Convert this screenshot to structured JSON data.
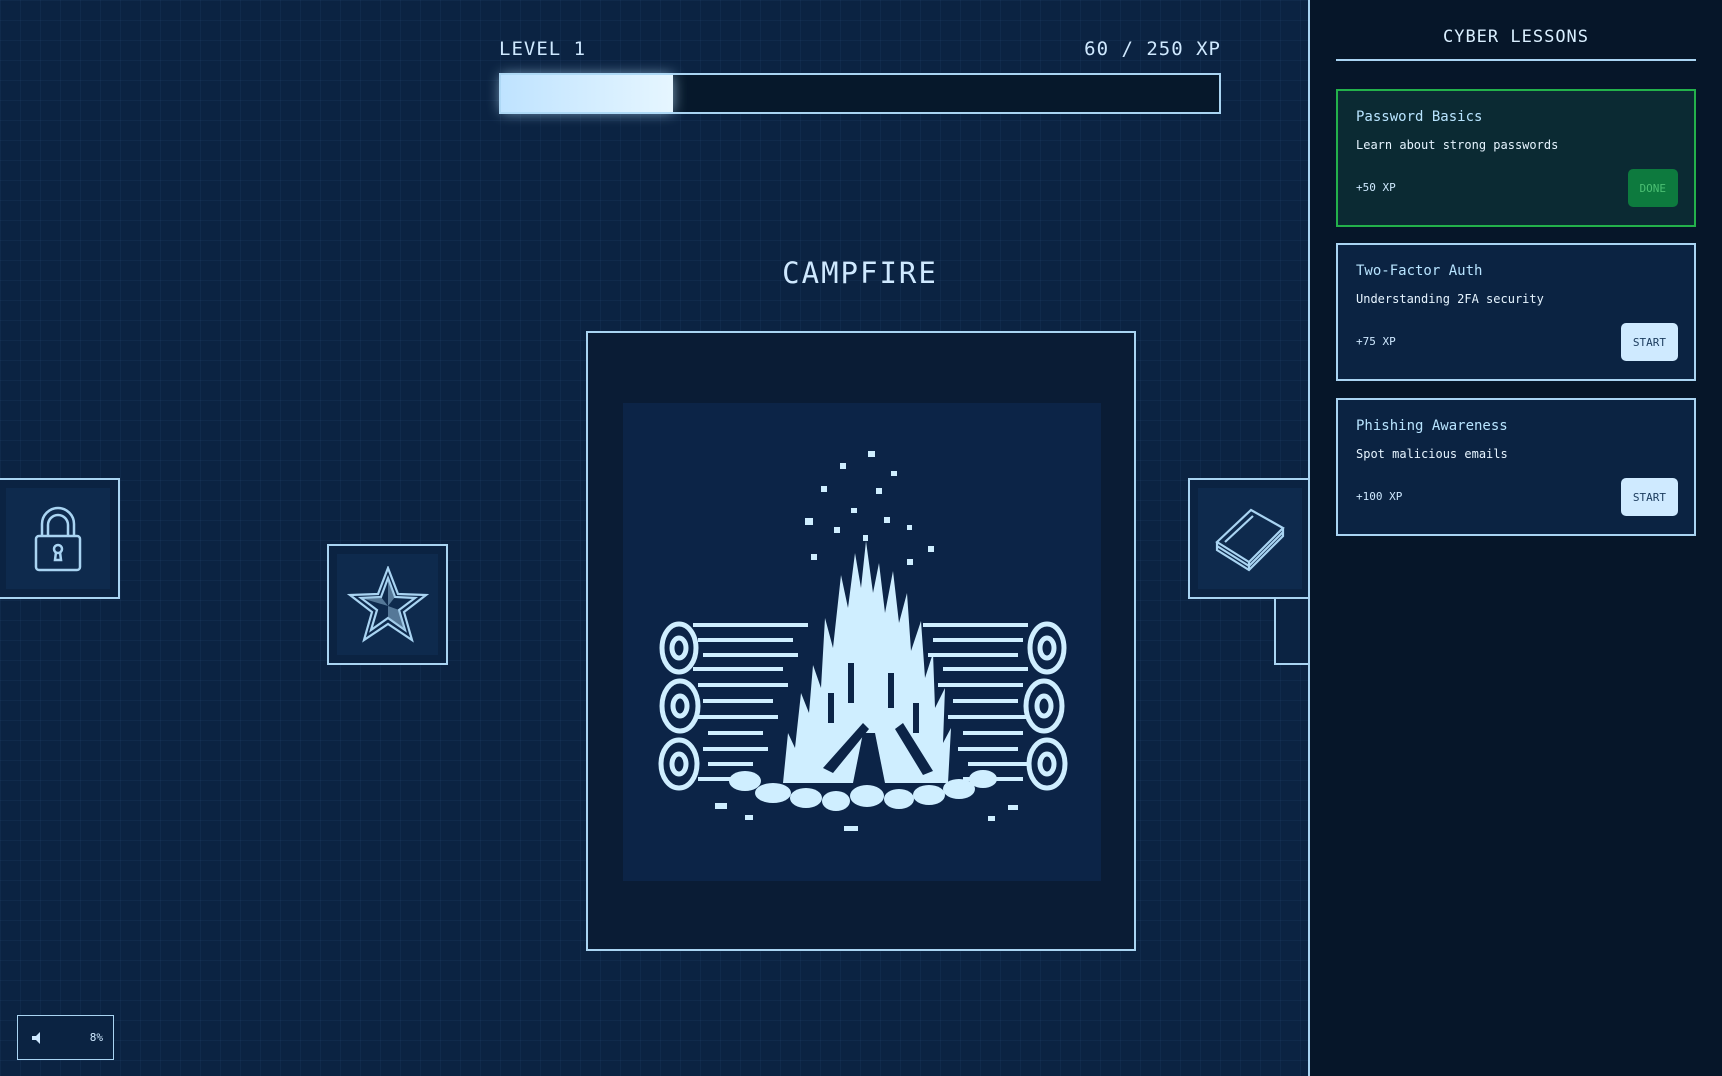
{
  "hud": {
    "level_label": "LEVEL 1",
    "xp_text": "60 / 250 XP",
    "xp_progress": 0.24
  },
  "room": {
    "title": "CAMPFIRE",
    "scene": "campfire-pixel-art"
  },
  "items": [
    {
      "icon": "padlock-icon"
    },
    {
      "icon": "star-icon"
    },
    {
      "icon": "book-icon"
    }
  ],
  "sound": {
    "icon": "speaker-icon",
    "volume_text": "8%"
  },
  "sidebar": {
    "title": "CYBER LESSONS",
    "lessons": [
      {
        "title": "Password Basics",
        "description": "Learn about strong passwords",
        "xp": "+50 XP",
        "button": "DONE",
        "status": "done"
      },
      {
        "title": "Two-Factor Auth",
        "description": "Understanding 2FA security",
        "xp": "+75 XP",
        "button": "START",
        "status": "available"
      },
      {
        "title": "Phishing Awareness",
        "description": "Spot malicious emails",
        "xp": "+100 XP",
        "button": "START",
        "status": "available"
      }
    ]
  },
  "colors": {
    "background": "#0b2342",
    "accent": "#a9d4f2",
    "done_green": "#23b14b"
  }
}
